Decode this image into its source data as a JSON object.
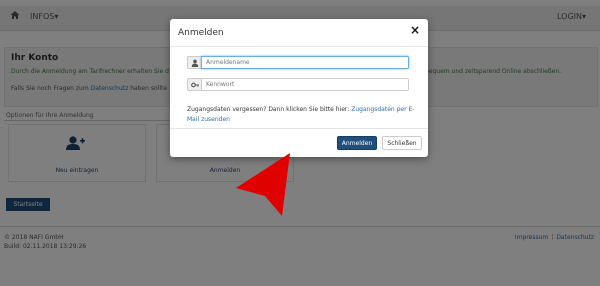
{
  "nav": {
    "home_icon": "home-icon",
    "infos_label": "INFOS",
    "login_label": "LOGIN"
  },
  "konto": {
    "title": "Ihr Konto",
    "text1": "Durch die Anmeldung am Tarifrechner erhalten Sie d",
    "text1_right": "bequem und zeitsparend Online abschließen.",
    "text2_prefix": "Falls Sie noch Fragen zum",
    "text2_link": "Datenschutz",
    "text2_suffix": "haben sollte"
  },
  "options": {
    "label": "Optionen für Ihre Anmeldung",
    "cards": [
      {
        "label": "Neu eintragen",
        "icon": "add-user-icon"
      },
      {
        "label": "Anmelden",
        "icon": "login-icon"
      }
    ]
  },
  "startseite_label": "Startseite",
  "footer": {
    "copyright": "© 2018 NAFI GmbH",
    "build": "Build: 02.11.2018 13:29:26",
    "impressum": "Impressum",
    "separator": "|",
    "datenschutz": "Datenschutz"
  },
  "modal": {
    "title": "Anmelden",
    "close": "×",
    "username_placeholder": "Anmeldename",
    "password_placeholder": "Kennwort",
    "username_icon": "user-icon",
    "password_icon": "key-icon",
    "forgot_text": "Zugangsdaten vergessen? Dann klicken Sie bitte hier:",
    "forgot_link": "Zugangsdaten per E-Mail zusenden",
    "submit_label": "Anmelden",
    "close_label": "Schließen"
  },
  "colors": {
    "primary": "#1f4f7a",
    "link": "#2c6fad",
    "arrow": "#e00000"
  }
}
